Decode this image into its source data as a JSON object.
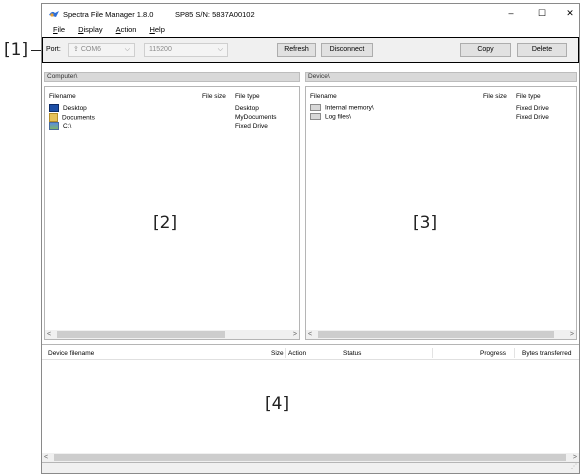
{
  "window": {
    "title": "Spectra File Manager 1.8.0",
    "serial": "SP85 S/N: 5837A00102",
    "controls": {
      "minimize": "–",
      "maximize": "☐",
      "close": "✕"
    }
  },
  "menu": [
    "File",
    "Display",
    "Action",
    "Help"
  ],
  "toolbar": {
    "port_label": "Port:",
    "port_value": "COM6",
    "baud_value": "115200",
    "refresh": "Refresh",
    "disconnect": "Disconnect",
    "copy": "Copy",
    "delete": "Delete"
  },
  "computer_pane": {
    "path": "Computer\\",
    "columns": [
      "Filename",
      "File size",
      "File type"
    ],
    "rows": [
      {
        "name": "Desktop",
        "size": "",
        "type": "Desktop",
        "icon": "desktop-icon"
      },
      {
        "name": "Documents",
        "size": "",
        "type": "MyDocuments",
        "icon": "documents-folder-icon"
      },
      {
        "name": "C:\\",
        "size": "",
        "type": "Fixed Drive",
        "icon": "drive-icon"
      }
    ],
    "tag": "[2]"
  },
  "device_pane": {
    "path": "Device\\",
    "columns": [
      "Filename",
      "File size",
      "File type"
    ],
    "rows": [
      {
        "name": "Internal memory\\",
        "size": "",
        "type": "Fixed Drive",
        "icon": "drive-icon"
      },
      {
        "name": "Log files\\",
        "size": "",
        "type": "Fixed Drive",
        "icon": "drive-icon"
      }
    ],
    "tag": "[3]"
  },
  "transfer_pane": {
    "columns": [
      "Device filename",
      "Size",
      "Action",
      "Status",
      "Progress",
      "Bytes transferred"
    ],
    "tag": "[4]"
  },
  "callouts": {
    "toolbar": "[1]"
  },
  "colors": {
    "accent": "#2f6fd6",
    "toolbar_border": "#000000",
    "pathbar": "#d9d9d9"
  }
}
